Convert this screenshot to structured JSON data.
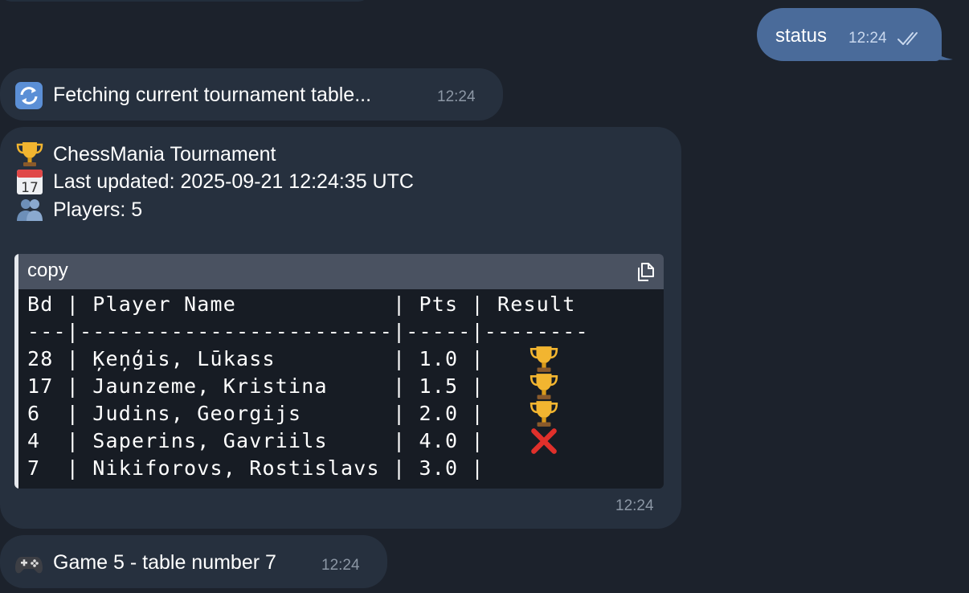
{
  "outgoing": {
    "text": "status",
    "time": "12:24",
    "status_icon": "double-check-icon"
  },
  "fetching": {
    "icon": "refresh-icon",
    "text": "Fetching current tournament table...",
    "time": "12:24"
  },
  "table_message": {
    "title_icon": "trophy-icon",
    "title": "ChessMania Tournament",
    "updated_icon": "calendar-icon",
    "updated": "Last updated: 2025-09-21 12:24:35 UTC",
    "players_icon": "people-icon",
    "players": "Players: 5",
    "code": {
      "language": "copy",
      "copy_icon": "copy-icon",
      "header": "Bd | Player Name            | Pts | Result",
      "separator": "---|------------------------|-----|--------",
      "rows": [
        {
          "text": "28 | Ķeņģis, Lūkass         | 1.0 |",
          "result": "trophy"
        },
        {
          "text": "17 | Jaunzeme, Kristina     | 1.5 |",
          "result": "trophy"
        },
        {
          "text": "6  | Judins, Georgijs       | 2.0 |",
          "result": "trophy"
        },
        {
          "text": "4  | Saperins, Gavriils     | 4.0 |",
          "result": "cross"
        },
        {
          "text": "7  | Nikiforovs, Rostislavs | 3.0 |",
          "result": ""
        }
      ]
    },
    "time": "12:24"
  },
  "game": {
    "icon": "gamepad-icon",
    "text": "Game 5 - table number 7",
    "time": "12:24"
  }
}
